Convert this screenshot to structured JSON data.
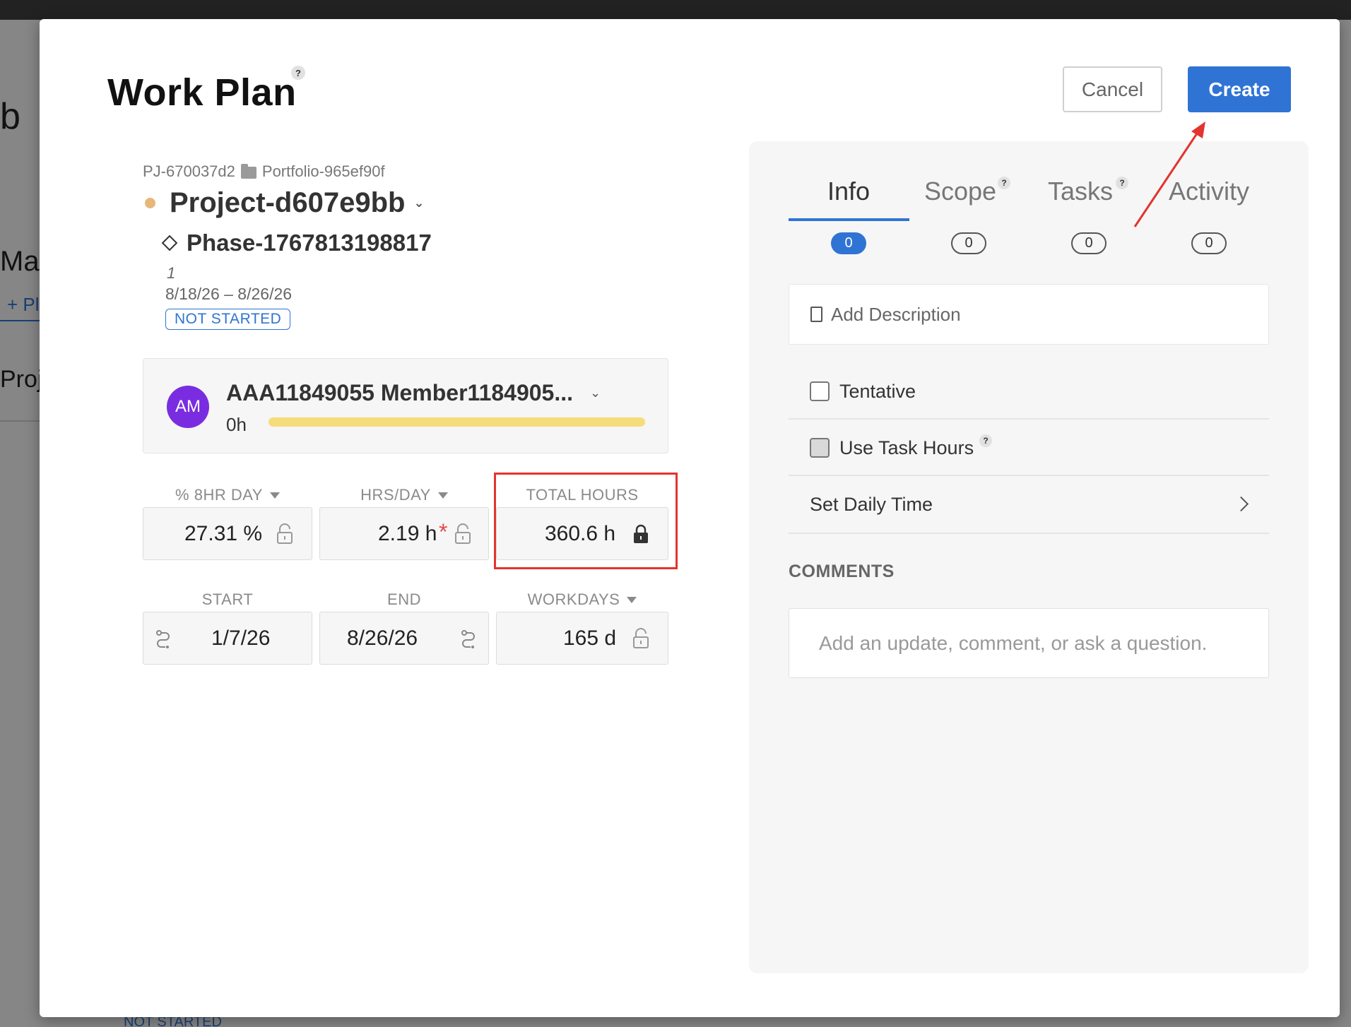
{
  "background": {
    "text_b": "b",
    "text_ma": "Ma",
    "text_plus": "+ Pl",
    "text_proj": "Proj",
    "status_text": "NOT STARTED"
  },
  "modal": {
    "title": "Work Plan",
    "help_glyph": "?",
    "cancel_label": "Cancel",
    "create_label": "Create"
  },
  "project": {
    "project_code": "PJ-670037d2",
    "portfolio": "Portfolio-965ef90f",
    "project_name": "Project-d607e9bb",
    "phase_name": "Phase-1767813198817",
    "small_number": "1",
    "date_range": "8/18/26 – 8/26/26",
    "status": "NOT STARTED",
    "status_color": "#2f74d4",
    "dot_color": "#e7b77a"
  },
  "member": {
    "initials": "AM",
    "name": "AAA11849055 Member1184905...",
    "hours": "0h",
    "avatar_color": "#7a2de0"
  },
  "fields": {
    "pct_day_label": "% 8HR DAY",
    "hrs_day_label": "HRS/DAY",
    "total_hours_label": "TOTAL HOURS",
    "pct_day_value": "27.31 %",
    "hrs_day_value": "2.19 h",
    "required_mark": "*",
    "total_hours_value": "360.6 h",
    "start_label": "START",
    "end_label": "END",
    "workdays_label": "WORKDAYS",
    "start_value": "1/7/26",
    "end_value": "8/26/26",
    "workdays_value": "165 d"
  },
  "tabs": [
    {
      "label": "Info",
      "count": "0"
    },
    {
      "label": "Scope",
      "count": "0"
    },
    {
      "label": "Tasks",
      "count": "0"
    },
    {
      "label": "Activity",
      "count": "0"
    }
  ],
  "panel": {
    "add_description": "Add Description",
    "tentative_label": "Tentative",
    "use_task_hours_label": "Use Task Hours",
    "set_daily_time_label": "Set Daily Time",
    "comments_title": "COMMENTS",
    "comment_placeholder": "Add an update, comment, or ask a question."
  },
  "colors": {
    "accent": "#2f74d4",
    "highlight": "#e3342f"
  }
}
